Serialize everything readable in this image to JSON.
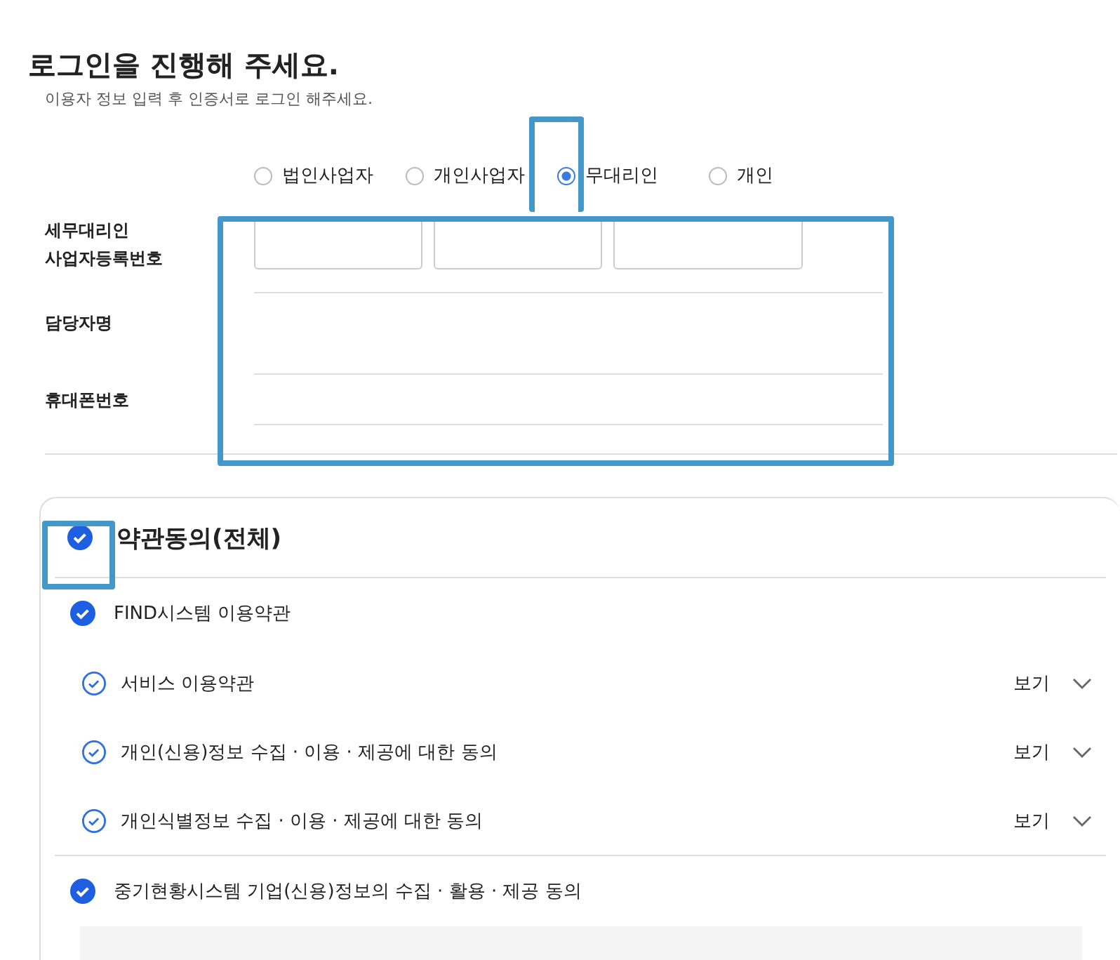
{
  "title": "로그인을 진행해 주세요.",
  "subtitle": "이용자 정보 입력 후 인증서로 로그인 해주세요.",
  "user_types": [
    {
      "label": "법인사업자",
      "selected": false
    },
    {
      "label": "개인사업자",
      "selected": false
    },
    {
      "label": "무대리인",
      "selected": true
    },
    {
      "label": "개인",
      "selected": false
    }
  ],
  "form": {
    "rows": [
      {
        "label": "세무대리인\n사업자등록번호",
        "kind": "triple"
      },
      {
        "label": "담당자명",
        "kind": "single"
      },
      {
        "label": "휴대폰번호",
        "kind": "single"
      }
    ]
  },
  "agreement": {
    "title": "약관동의(전체)",
    "checked": true,
    "groups": [
      {
        "label": "FIND시스템 이용약관",
        "checked": true,
        "children": [
          {
            "label": "서비스 이용약관",
            "checked": true,
            "view": "보기"
          },
          {
            "label": "개인(신용)정보 수집 · 이용 · 제공에 대한 동의",
            "checked": true,
            "view": "보기"
          },
          {
            "label": "개인식별정보 수집 · 이용 · 제공에 대한 동의",
            "checked": true,
            "view": "보기"
          }
        ]
      },
      {
        "label": "중기현황시스템 기업(신용)정보의 수집 · 활용 · 제공 동의",
        "checked": true
      }
    ]
  }
}
